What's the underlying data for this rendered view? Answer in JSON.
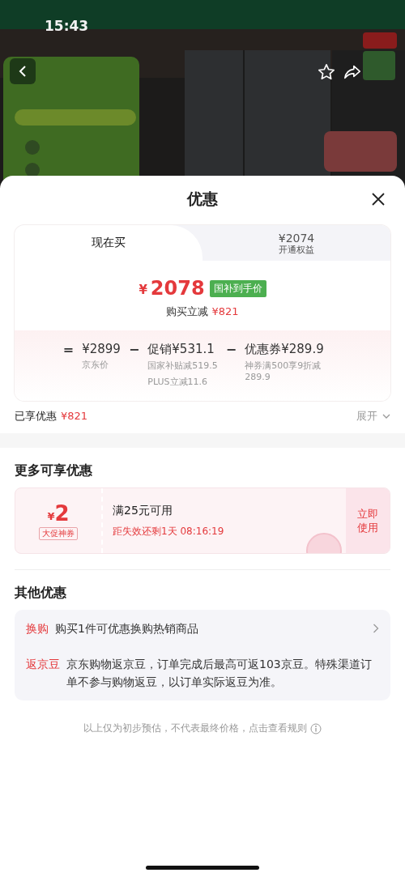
{
  "status_bar": {
    "time": "15:43"
  },
  "sheet": {
    "title": "优惠"
  },
  "price_card": {
    "tabs": [
      {
        "kind": "plain",
        "label": "现在买",
        "selected": true
      },
      {
        "kind": "price",
        "price": "¥2074",
        "label": "开通权益",
        "selected": false
      }
    ],
    "final_price": {
      "currency": "¥",
      "amount": "2078",
      "tag": "国补到手价"
    },
    "reduction": {
      "label": "购买立减",
      "value": "¥821"
    },
    "breakdown": [
      {
        "kind": "op",
        "text": "="
      },
      {
        "kind": "term",
        "text": "¥2899",
        "notes": [
          "京东价"
        ]
      },
      {
        "kind": "op",
        "text": "−"
      },
      {
        "kind": "term",
        "text": "促销¥531.1",
        "notes": [
          "国家补贴减519.5",
          "PLUS立减11.6"
        ]
      },
      {
        "kind": "op",
        "text": "−"
      },
      {
        "kind": "term",
        "text": "优惠券¥289.9",
        "notes": [
          "神券满500享9折减289.9"
        ]
      }
    ]
  },
  "enjoyed": {
    "label": "已享优惠",
    "value": "¥821",
    "toggle": "展开",
    "expanded": false
  },
  "more_offers": {
    "title": "更多可享优惠",
    "coupons": [
      {
        "currency": "¥",
        "amount": "2",
        "tag": "大促神券",
        "condition": "满25元可用",
        "countdown": "距失效还剩1天 08:16:19",
        "action": "立即使用"
      }
    ]
  },
  "other_offers": {
    "title": "其他优惠",
    "items": [
      {
        "tag": "换购",
        "text": "购买1件可优惠换购热销商品",
        "link": true
      },
      {
        "tag": "返京豆",
        "text": "京东购物返京豆，订单完成后最高可返103京豆。特殊渠道订单不参与购物返豆，以订单实际返豆为准。",
        "link": false
      }
    ]
  },
  "footer_note": "以上仅为初步预估，不代表最终价格，点击查看规则"
}
